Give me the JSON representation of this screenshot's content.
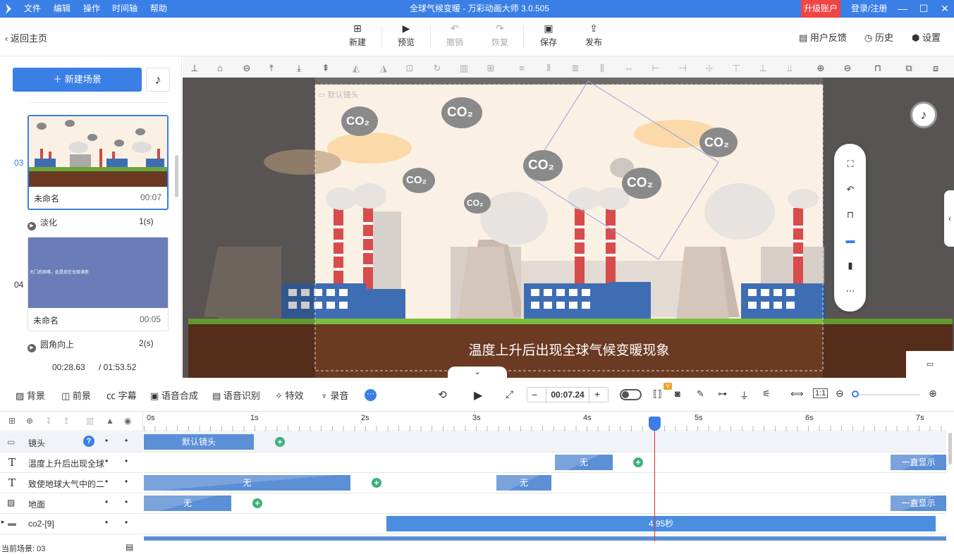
{
  "titlebar": {
    "menu": [
      "文件",
      "编辑",
      "操作",
      "时间轴",
      "帮助"
    ],
    "title": "全球气候变暖 - 万彩动画大师 3.0.505",
    "upgrade": "升级账户",
    "login": "登录/注册",
    "min": "—",
    "max": "☐",
    "close": "✕"
  },
  "toolbar": {
    "back": "返回主页",
    "new": "新建",
    "preview": "预览",
    "undo": "撤销",
    "redo": "恢复",
    "save": "保存",
    "publish": "发布",
    "feedback": "用户反馈",
    "history": "历史",
    "settings": "设置"
  },
  "leftpanel": {
    "new_scene": "新建场景",
    "scenes": [
      {
        "num": "03",
        "name": "未命名",
        "time": "00:07",
        "transition": "淡化",
        "transition_time": "1(s)"
      },
      {
        "num": "04",
        "name": "未命名",
        "time": "00:05",
        "transition": "圆角向上",
        "transition_time": "2(s)",
        "thumb_text": "大门后困难，此是现在无极满意"
      }
    ],
    "current_time": "00:28.63",
    "total_time": "/ 01:53.52"
  },
  "stage": {
    "camera_label": "默认镜头",
    "co2": "CO₂",
    "subtitle": "温度上升后出现全球气候变暖现象"
  },
  "bottom_toolbar": {
    "background": "背景",
    "foreground": "前景",
    "subtitle": "字幕",
    "tts": "语音合成",
    "asr": "语音识别",
    "effects": "特效",
    "record": "录音",
    "time": "00:07.24",
    "v_badge": "V"
  },
  "timeline": {
    "ticks": [
      "0s",
      "1s",
      "2s",
      "3s",
      "4s",
      "5s",
      "6s",
      "7s"
    ],
    "tracks": [
      {
        "label": "镜头"
      },
      {
        "label": "温度上升后出现全球"
      },
      {
        "label": "致使地球大气中的二"
      },
      {
        "label": "地面"
      },
      {
        "label": "co2-[9]"
      }
    ],
    "clip_camera": "默认镜头",
    "clip_none": "无",
    "clip_always": "一直显示",
    "clip_duration": "4.95秒"
  },
  "statusbar": {
    "current_scene": "当前场景: 03"
  },
  "colors": {
    "accent": "#3a7fe6",
    "upgrade": "#f04545",
    "clip": "#5b8fd6",
    "keyframe": "#3eb27a",
    "playhead": "#e03030"
  }
}
